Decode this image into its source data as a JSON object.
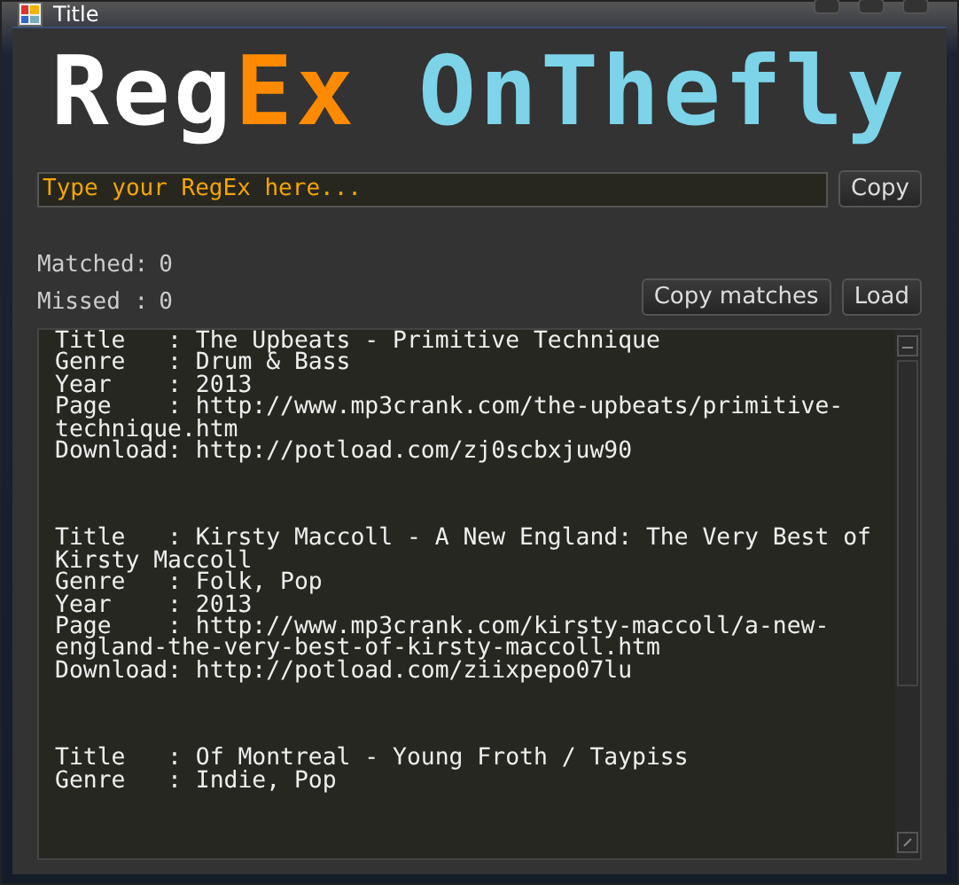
{
  "window": {
    "title": "Title"
  },
  "logo": [
    {
      "text": "Reg",
      "color": "#ffffff"
    },
    {
      "text": "Ex",
      "color": "#ff8a00"
    },
    {
      "text": " OnThefly",
      "color": "#7dd3e8"
    }
  ],
  "regex_field": {
    "placeholder": "Type your RegEx here..."
  },
  "copy_button": "Copy",
  "matched": {
    "label": "Matched:",
    "value": "0"
  },
  "missed": {
    "label": "Missed :",
    "value": "0"
  },
  "buttons": [
    "Copy matches",
    "Load"
  ],
  "records": [
    {
      "lines": [
        "Title   : The Upbeats - Primitive Technique",
        "Genre   : Drum & Bass",
        "Year    : 2013",
        "Page    : http://www.mp3crank.com/the-upbeats/primitive-technique.htm",
        "Download: http://potload.com/zj0scbxjuw90"
      ]
    },
    {
      "lines": [
        "Title   : Kirsty Maccoll - A New England: The Very Best of Kirsty Maccoll",
        "Genre   : Folk, Pop",
        "Year    : 2013",
        "Page    : http://www.mp3crank.com/kirsty-maccoll/a-new-england-the-very-best-of-kirsty-maccoll.htm",
        "Download: http://potload.com/ziixpepo07lu"
      ]
    },
    {
      "lines": [
        "Title   : Of Montreal - Young Froth / Taypiss",
        "Genre   : Indie, Pop"
      ]
    }
  ]
}
